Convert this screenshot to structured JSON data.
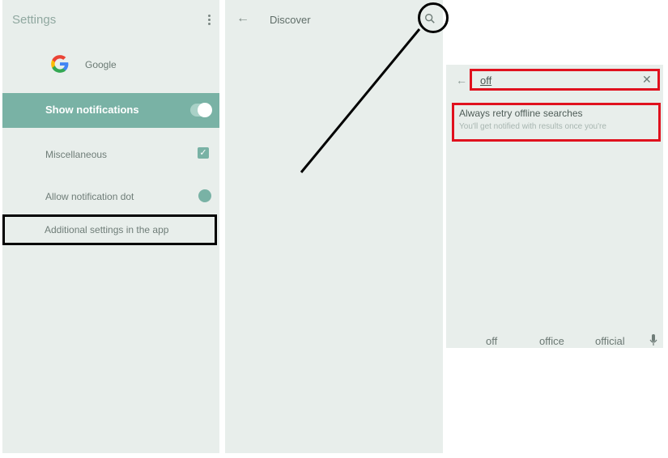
{
  "settings_screen": {
    "title": "Settings",
    "app_name": "Google",
    "show_notifications_label": "Show notifications",
    "show_notifications_on": true,
    "items": [
      {
        "label": "Miscellaneous",
        "checked": true
      },
      {
        "label": "Allow notification dot",
        "enabled": true
      }
    ],
    "additional_settings_label": "Additional settings in the app"
  },
  "discover_screen": {
    "title": "Discover",
    "icons": [
      "back-arrow-icon",
      "search-icon"
    ]
  },
  "search_screen": {
    "query": "off",
    "result": {
      "title": "Always retry offline searches",
      "subtitle": "You'll get notified with results once you're"
    },
    "suggestions": [
      "off",
      "office",
      "official"
    ],
    "icons": [
      "back-arrow-icon",
      "clear-icon",
      "mic-icon"
    ]
  },
  "annotation_colors": {
    "black_highlight": "#000000",
    "red_highlight": "#e0111e",
    "accent": "#79b2a5"
  }
}
